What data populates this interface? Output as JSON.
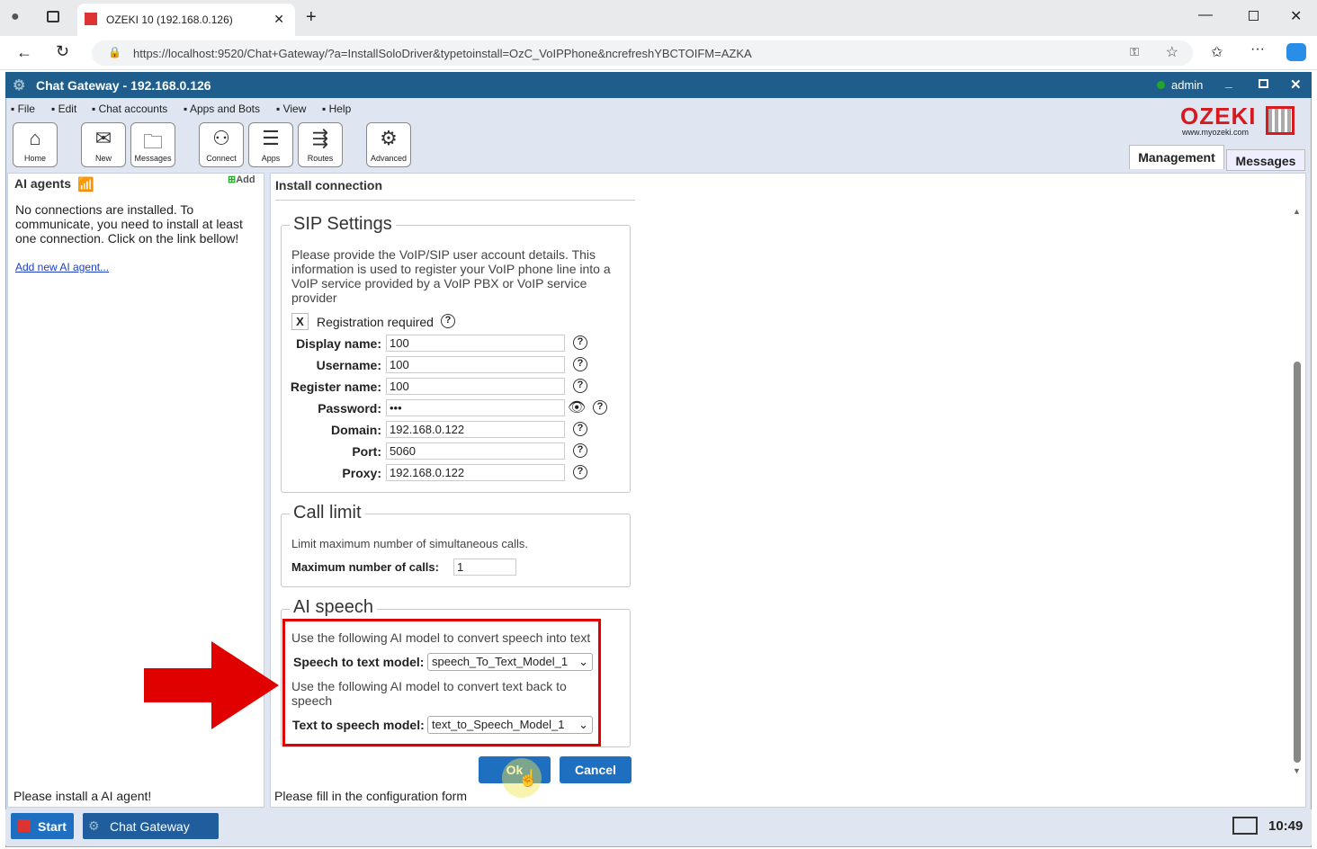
{
  "browser": {
    "tab_title": "OZEKI 10 (192.168.0.126)",
    "url": "https://localhost:9520/Chat+Gateway/?a=InstallSoloDriver&typetoinstall=OzC_VoIPPhone&ncrefreshYBCTOIFM=AZKA"
  },
  "app": {
    "title": "Chat Gateway - 192.168.0.126",
    "user": "admin",
    "status_color": "#22a52a"
  },
  "menu": [
    "File",
    "Edit",
    "Chat accounts",
    "Apps and Bots",
    "View",
    "Help"
  ],
  "toolbar": [
    "Home",
    "New",
    "Messages",
    "Connect",
    "Apps",
    "Routes",
    "Advanced"
  ],
  "logo": {
    "text": "OZEKI",
    "sub": "www.myozeki.com"
  },
  "tabs": [
    "Management",
    "Messages"
  ],
  "left": {
    "title": "AI agents",
    "add": "Add",
    "message": "No connections are installed. To communicate, you need to install at least one connection. Click on the link bellow!",
    "link": "Add new AI agent...",
    "status": "Please install a AI agent!"
  },
  "main": {
    "title": "Install connection",
    "status": "Please fill in the configuration form"
  },
  "sip": {
    "legend": "SIP Settings",
    "desc": "Please provide the VoIP/SIP user account details. This information is used to register your VoIP phone line into a VoIP service provided by a VoIP PBX or VoIP service provider",
    "reg_check": "X",
    "reg_label": "Registration required",
    "fields": [
      {
        "label": "Display name:",
        "value": "100"
      },
      {
        "label": "Username:",
        "value": "100"
      },
      {
        "label": "Register name:",
        "value": "100"
      },
      {
        "label": "Password:",
        "value": "•••"
      },
      {
        "label": "Domain:",
        "value": "192.168.0.122"
      },
      {
        "label": "Port:",
        "value": "5060"
      },
      {
        "label": "Proxy:",
        "value": "192.168.0.122"
      }
    ]
  },
  "call_limit": {
    "legend": "Call limit",
    "desc": "Limit maximum number of simultaneous calls.",
    "label": "Maximum number of calls:",
    "value": "1"
  },
  "ai_speech": {
    "legend": "AI speech",
    "stt_desc": "Use the following AI model to convert speech into text",
    "stt_label": "Speech to text model:",
    "stt_value": "speech_To_Text_Model_1",
    "tts_desc": "Use the following AI model to convert text back to speech",
    "tts_label": "Text to speech model:",
    "tts_value": "text_to_Speech_Model_1"
  },
  "buttons": {
    "ok": "Ok",
    "cancel": "Cancel"
  },
  "taskbar": {
    "start": "Start",
    "app": "Chat Gateway",
    "clock": "10:49"
  },
  "help_glyph": "?",
  "highlight_color": "#e00000"
}
